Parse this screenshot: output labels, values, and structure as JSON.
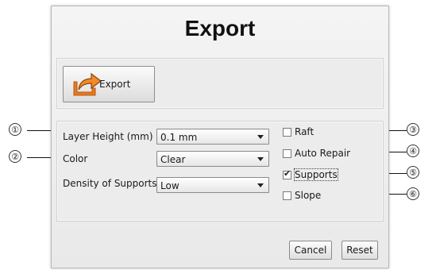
{
  "dialog": {
    "title": "Export",
    "export_button_label": "Export",
    "fields": [
      {
        "label": "Layer Height (mm)",
        "value": "0.1 mm"
      },
      {
        "label": "Color",
        "value": "Clear"
      },
      {
        "label": "Density of Supports",
        "value": "Low"
      }
    ],
    "checkboxes": [
      {
        "label": "Raft",
        "checked": false
      },
      {
        "label": "Auto Repair",
        "checked": false
      },
      {
        "label": "Supports",
        "checked": true
      },
      {
        "label": "Slope",
        "checked": false
      }
    ],
    "cancel_label": "Cancel",
    "reset_label": "Reset"
  },
  "callouts": [
    "①",
    "②",
    "③",
    "④",
    "⑤",
    "⑥"
  ],
  "icons": {
    "export": "export-arrow-icon",
    "check": "checkmark-icon",
    "dropdown": "chevron-down-icon"
  }
}
